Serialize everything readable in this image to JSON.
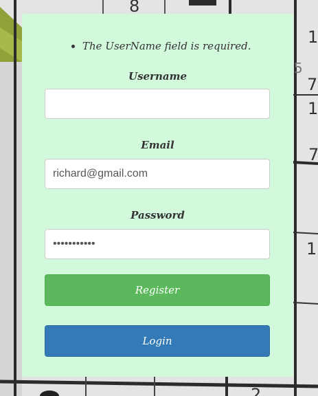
{
  "validation": {
    "errors": [
      "The UserName field is required."
    ]
  },
  "form": {
    "username": {
      "label": "Username",
      "value": "",
      "placeholder": ""
    },
    "email": {
      "label": "Email",
      "value": "richard@gmail.com",
      "placeholder": ""
    },
    "password": {
      "label": "Password",
      "value": "passwordxyz",
      "placeholder": ""
    }
  },
  "buttons": {
    "register_label": "Register",
    "login_label": "Login"
  },
  "background": {
    "visible_digits": [
      "8",
      "1",
      "5",
      "7",
      "1",
      "7",
      "1",
      "2"
    ]
  },
  "colors": {
    "card_bg": "#d3f9dd",
    "register_green": "#5cb85c",
    "login_blue": "#337ab7",
    "text": "#333333"
  }
}
